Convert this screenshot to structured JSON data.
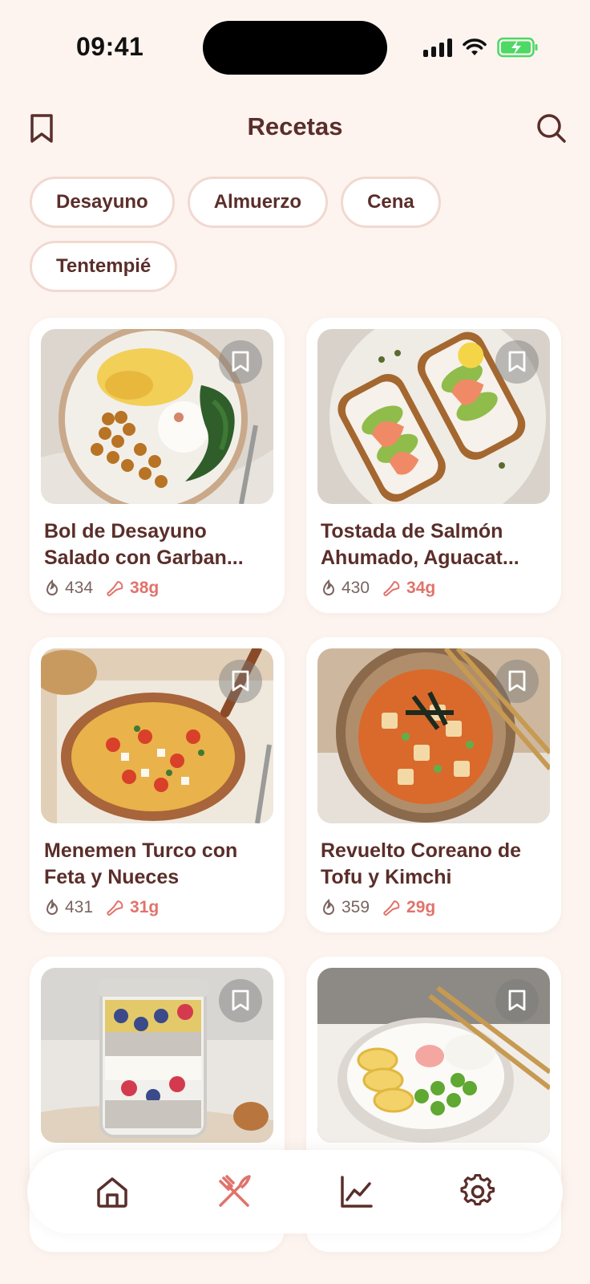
{
  "status_bar": {
    "time": "09:41"
  },
  "header": {
    "title": "Recetas",
    "left_icon": "bookmark-icon",
    "right_icon": "search-icon"
  },
  "filters": [
    "Desayuno",
    "Almuerzo",
    "Cena",
    "Tentempié"
  ],
  "recipes": [
    {
      "title": "Bol de Desayuno Salado con Garban...",
      "kcal": "434",
      "protein": "38g"
    },
    {
      "title": "Tostada de Salmón Ahumado, Aguacat...",
      "kcal": "430",
      "protein": "34g"
    },
    {
      "title": "Menemen Turco con Feta y Nueces",
      "kcal": "431",
      "protein": "31g"
    },
    {
      "title": "Revuelto Coreano de Tofu y Kimchi",
      "kcal": "359",
      "protein": "29g"
    },
    {
      "title": "",
      "kcal": "",
      "protein": ""
    },
    {
      "title": "",
      "kcal": "",
      "protein": ""
    }
  ],
  "nav": {
    "items": [
      "home-icon",
      "fork-knife-icon",
      "chart-icon",
      "gear-icon"
    ],
    "active": "fork-knife-icon"
  },
  "colors": {
    "background": "#fdf4f0",
    "text": "#5a2e2a",
    "accent": "#e0736b"
  }
}
